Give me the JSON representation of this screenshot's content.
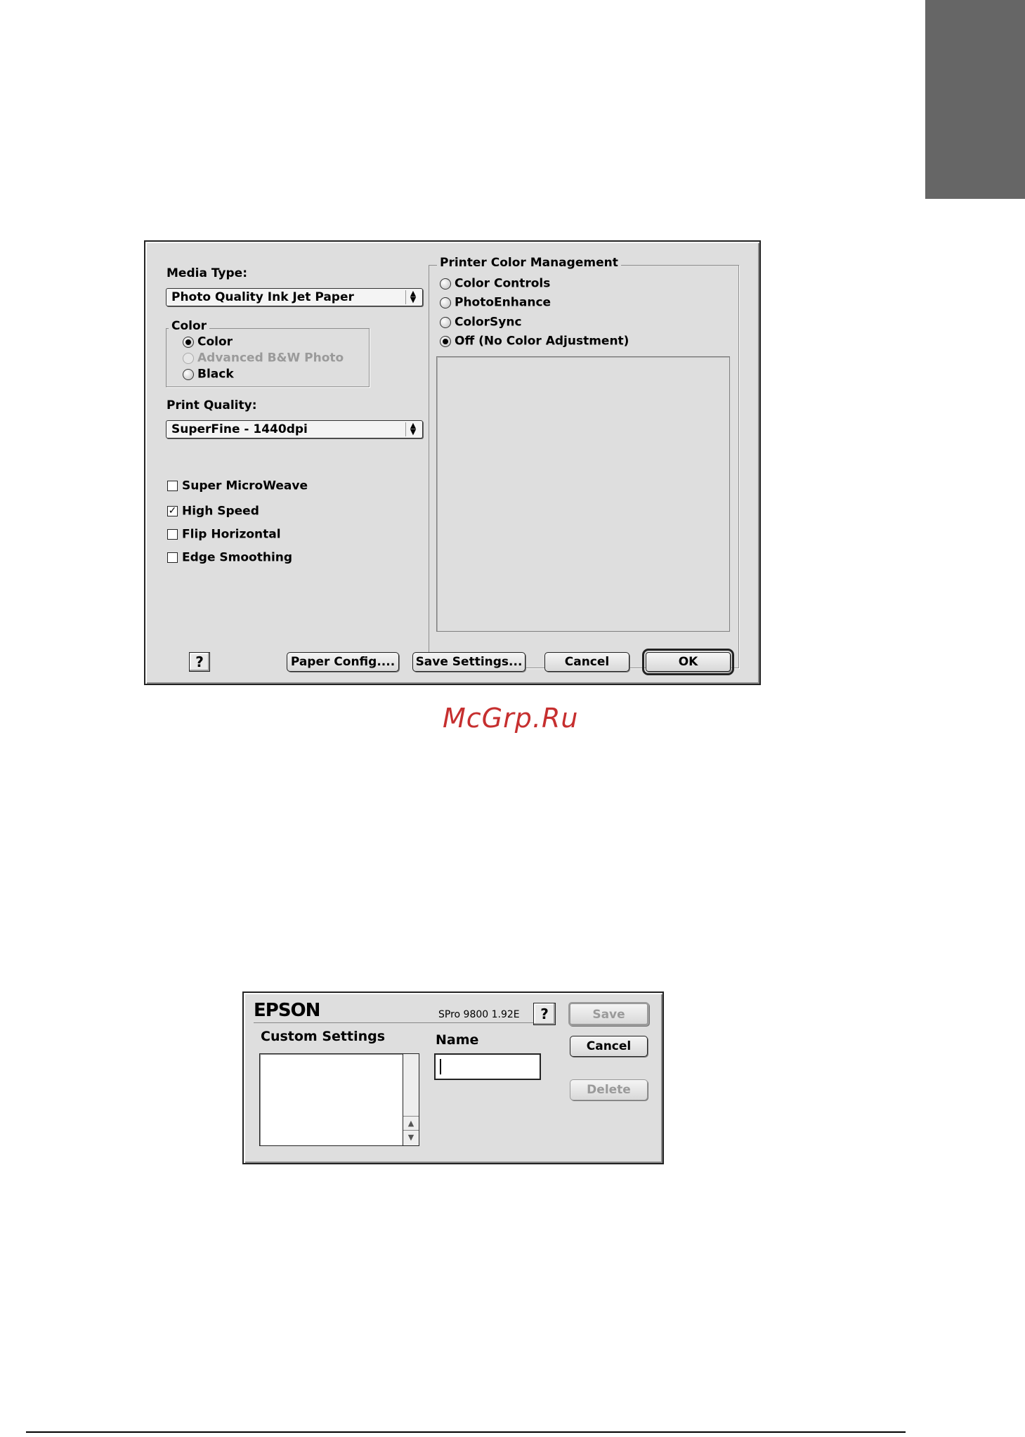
{
  "watermark": "McGrp.Ru",
  "print_dialog": {
    "media_type": {
      "label": "Media Type:",
      "value": "Photo Quality Ink Jet Paper"
    },
    "color_group": {
      "title": "Color",
      "options": [
        {
          "label": "Color",
          "selected": true,
          "enabled": true
        },
        {
          "label": "Advanced B&W Photo",
          "selected": false,
          "enabled": false
        },
        {
          "label": "Black",
          "selected": false,
          "enabled": true
        }
      ]
    },
    "print_quality": {
      "label": "Print Quality:",
      "value": "SuperFine - 1440dpi"
    },
    "checkboxes": [
      {
        "label": "Super MicroWeave",
        "checked": false
      },
      {
        "label": "High Speed",
        "checked": true
      },
      {
        "label": "Flip Horizontal",
        "checked": false
      },
      {
        "label": "Edge Smoothing",
        "checked": false
      }
    ],
    "color_management": {
      "title": "Printer Color Management",
      "options": [
        {
          "label": "Color Controls",
          "selected": false
        },
        {
          "label": "PhotoEnhance",
          "selected": false
        },
        {
          "label": "ColorSync",
          "selected": false
        },
        {
          "label": "Off (No Color Adjustment)",
          "selected": true
        }
      ]
    },
    "buttons": {
      "help": "?",
      "paper_config": "Paper Config....",
      "save_settings": "Save Settings...",
      "cancel": "Cancel",
      "ok": "OK"
    }
  },
  "save_dialog": {
    "logo": "EPSON",
    "version": "SPro 9800 1.92E",
    "help": "?",
    "custom_settings_label": "Custom Settings",
    "name_label": "Name",
    "name_value": "",
    "buttons": {
      "save": "Save",
      "cancel": "Cancel",
      "delete": "Delete"
    }
  },
  "colors": {
    "side_tab": "#666666",
    "dialog_bg": "#dedede",
    "watermark": "#c62f2f"
  }
}
